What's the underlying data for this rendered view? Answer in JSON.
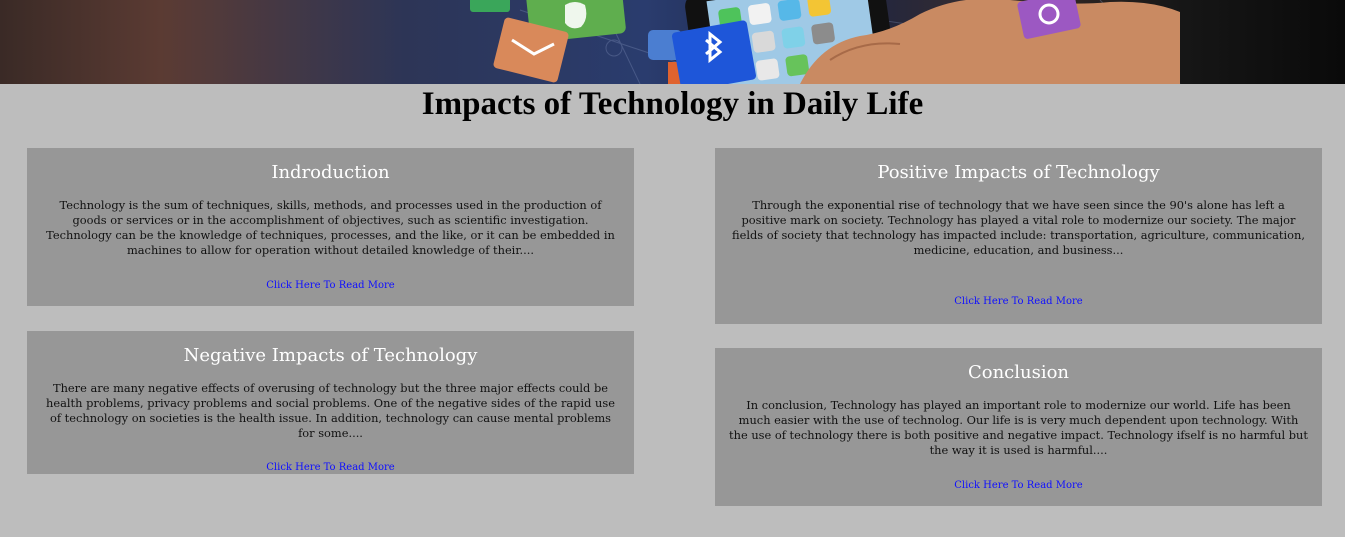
{
  "page": {
    "title": "Impacts of Technology in Daily Life"
  },
  "banner": {
    "image_description_icons": [
      "email-app-icon",
      "evernote-app-icon",
      "bluetooth-icon",
      "circle-app-icon",
      "smartphone-hand"
    ]
  },
  "sections": {
    "intro": {
      "heading": "Indroduction",
      "body": "Technology is the sum of techniques, skills, methods, and processes used in the production of goods or services or in the accomplishment of objectives, such as scientific investigation. Technology can be the knowledge of techniques, processes, and the like, or it can be embedded in machines to allow for operation without detailed knowledge of their....",
      "link": "Click Here To Read More"
    },
    "positive": {
      "heading": "Positive Impacts of Technology",
      "body": "Through the exponential rise of technology that we have seen since the 90's alone has left a positive mark on society. Technology has played a vital role to modernize our society. The major fields of society that technology has impacted include: transportation, agriculture, communication, medicine, education, and business...",
      "link": "Click Here To Read More"
    },
    "negative": {
      "heading": "Negative Impacts of Technology",
      "body": "There are many negative effects of overusing of technology but the three major effects could be health problems, privacy problems and social problems. One of the negative sides of the rapid use of technology on societies is the health issue. In addition, technology can cause mental problems for some....",
      "link": "Click Here To Read More"
    },
    "conclusion": {
      "heading": "Conclusion",
      "body": "In conclusion, Technology has played an important role to modernize our world. Life has been much easier with the use of technolog. Our life is is very much dependent upon technology. With the use of technology there is both positive and negative impact. Technology ifself is no harmful but the way it is used is harmful....",
      "link": "Click Here To Read More"
    }
  },
  "colors": {
    "background": "#bdbdbd",
    "card": "#979797",
    "heading": "#ffffff",
    "link": "#1010ff"
  }
}
